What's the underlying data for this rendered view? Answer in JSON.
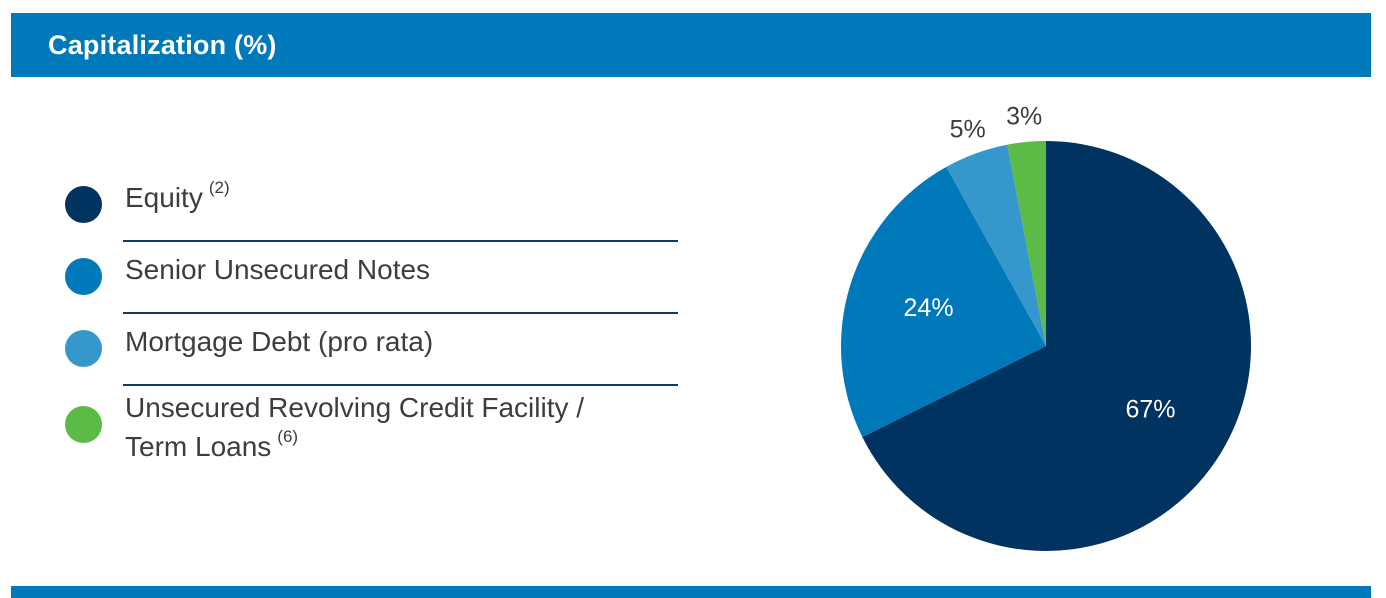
{
  "header": {
    "title": "Capitalization (%)"
  },
  "colors": {
    "header_bar": "#0079bb",
    "equity": "#00335f",
    "senior_notes": "#0079bb",
    "mortgage": "#3597cc",
    "revolver": "#5cba47"
  },
  "legend": {
    "items": [
      {
        "label": "Equity",
        "footnote": "(2)",
        "color": "#00335f"
      },
      {
        "label": "Senior Unsecured Notes",
        "footnote": "",
        "color": "#0079bb"
      },
      {
        "label": "Mortgage Debt (pro rata)",
        "footnote": "",
        "color": "#3597cc"
      },
      {
        "label_line1": "Unsecured Revolving Credit Facility /",
        "label_line2": "Term Loans",
        "footnote": "(6)",
        "color": "#5cba47"
      }
    ]
  },
  "chart_data": {
    "type": "pie",
    "title": "Capitalization (%)",
    "slices": [
      {
        "label": "Equity",
        "value": 67,
        "display": "67%",
        "color": "#00335f"
      },
      {
        "label": "Senior Unsecured Notes",
        "value": 24,
        "display": "24%",
        "color": "#0079bb"
      },
      {
        "label": "Mortgage Debt (pro rata)",
        "value": 5,
        "display": "5%",
        "color": "#3597cc"
      },
      {
        "label": "Unsecured Revolving Credit Facility / Term Loans",
        "value": 3,
        "display": "3%",
        "color": "#5cba47"
      }
    ],
    "start": "12 o'clock",
    "direction": "clockwise",
    "label_placement": {
      "Equity": "inside",
      "Senior Unsecured Notes": "inside",
      "Mortgage Debt (pro rata)": "outside",
      "Unsecured Revolving Credit Facility / Term Loans": "outside"
    }
  }
}
